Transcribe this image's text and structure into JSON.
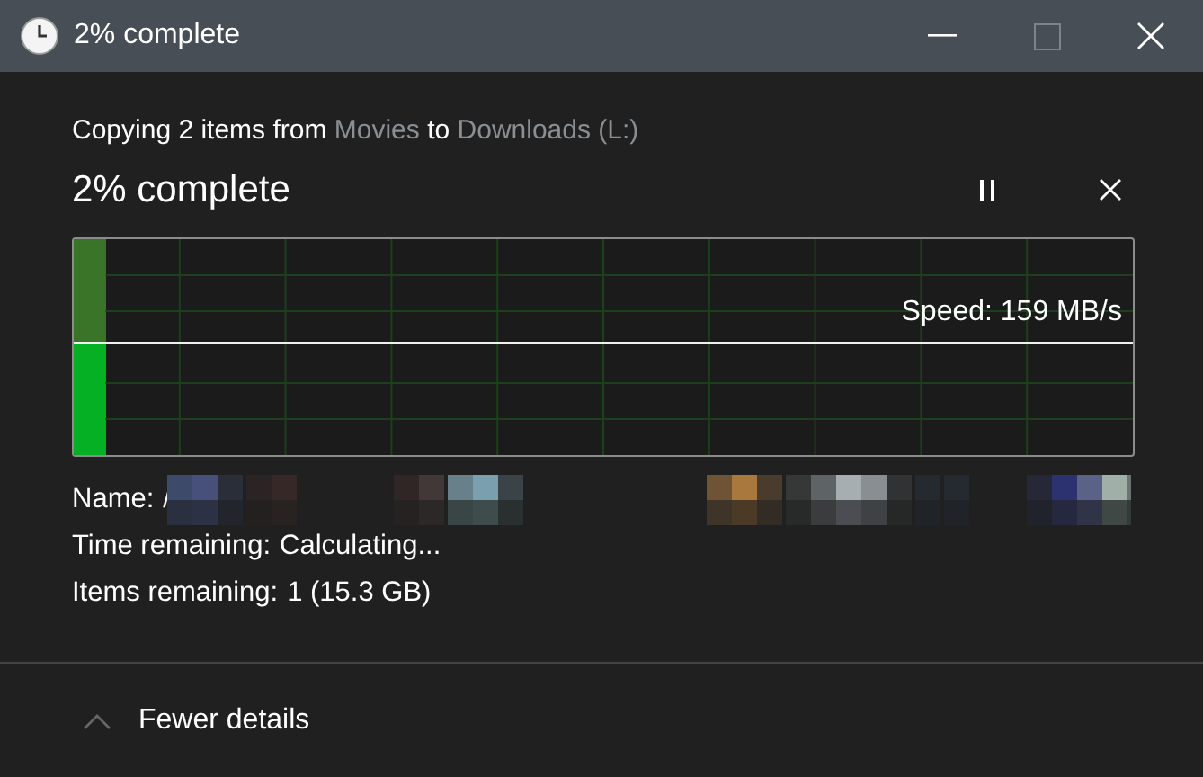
{
  "window": {
    "title": "2% complete"
  },
  "header": {
    "prefix": "Copying 2 items from",
    "source": "Movies",
    "joiner": "to",
    "destination": "Downloads (L:)"
  },
  "status": "2% complete",
  "progress": {
    "speed": "Speed: 159 MB/s"
  },
  "details": [
    {
      "label": "Name:",
      "value": "/",
      "kind": "redacted"
    },
    {
      "label": "Time remaining:",
      "value": "Calculating...",
      "kind": "text"
    },
    {
      "label": "Items remaining:",
      "value": "1 (15.3 GB)",
      "kind": "text"
    }
  ],
  "toggle": {
    "label": "Fewer details",
    "expanded": true
  }
}
